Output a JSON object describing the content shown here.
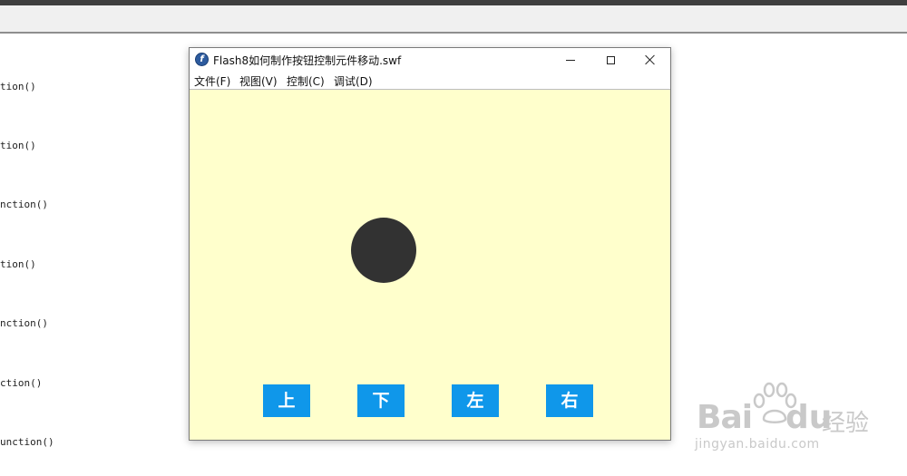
{
  "background_code": {
    "lines": [
      "tion()",
      "tion()",
      "nction()",
      "tion()",
      "nction()",
      "ction()",
      "unction()"
    ]
  },
  "flash_window": {
    "title": "Flash8如何制作按钮控制元件移动.swf",
    "menu": [
      "文件(F)",
      "视图(V)",
      "控制(C)",
      "调试(D)"
    ],
    "stage_color": "#ffffcc",
    "ball_color": "#323232",
    "buttons": [
      "上",
      "下",
      "左",
      "右"
    ],
    "button_color": "#0f97ea"
  },
  "watermark": {
    "brand_left": "Bai",
    "brand_right": "du",
    "brand_cn": "经验",
    "url": "jingyan.baidu.com"
  }
}
